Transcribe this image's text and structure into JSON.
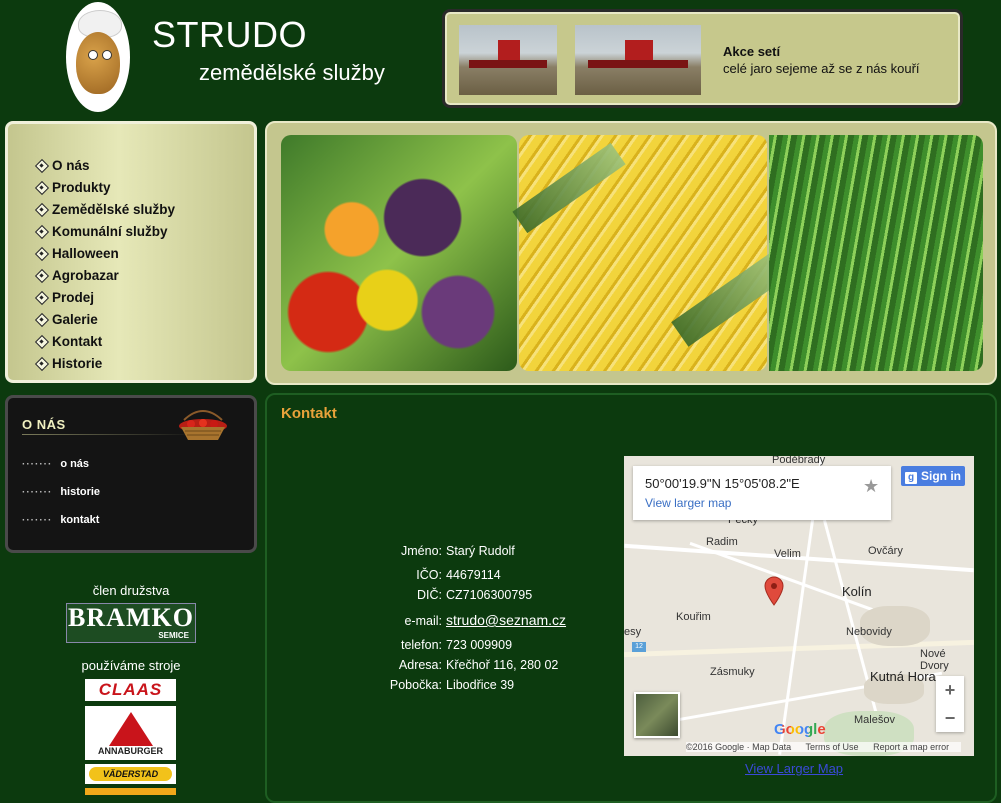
{
  "header": {
    "title": "STRUDO",
    "subtitle": "zemědělské služby"
  },
  "promo": {
    "title": "Akce setí",
    "text": "celé jaro sejeme až se z nás kouří"
  },
  "nav": {
    "items": [
      {
        "label": "O nás"
      },
      {
        "label": "Produkty"
      },
      {
        "label": "Zemědělské služby"
      },
      {
        "label": "Komunální služby"
      },
      {
        "label": "Halloween"
      },
      {
        "label": "Agrobazar"
      },
      {
        "label": "Prodej"
      },
      {
        "label": "Galerie"
      },
      {
        "label": "Kontakt"
      },
      {
        "label": "Historie"
      }
    ]
  },
  "section_box": {
    "title": "O NÁS",
    "dots": "·······",
    "links": [
      {
        "label": "o nás"
      },
      {
        "label": "historie"
      },
      {
        "label": "kontakt"
      }
    ]
  },
  "sidebar": {
    "member_text": "člen družstva",
    "bramko_logo": "BRAMKO",
    "bramko_sub": "SEMICE",
    "machines_text": "používáme stroje",
    "claas": "CLAAS",
    "annaburger": "ANNABURGER",
    "vaderstad": "VÄDERSTAD"
  },
  "content": {
    "title": "Kontakt",
    "fields": [
      {
        "label": "Jméno:",
        "value": "Starý Rudolf"
      },
      {
        "label": "IČO:",
        "value": "44679114"
      },
      {
        "label": "DIČ:",
        "value": "CZ7106300795"
      },
      {
        "label": "e-mail:",
        "value": "strudo@seznam.cz"
      },
      {
        "label": "telefon:",
        "value": "723 009909"
      },
      {
        "label": "Adresa:",
        "value": "Křečhoř 116, 280 02"
      },
      {
        "label": "Pobočka:",
        "value": "Libodřice 39"
      }
    ]
  },
  "map": {
    "coords": "50°00'19.9\"N 15°05'08.2\"E",
    "view_larger": "View larger map",
    "sign_in": "Sign in",
    "towns": [
      "Poděbrady",
      "Pecky",
      "Radim",
      "Velim",
      "Ovčáry",
      "Kolín",
      "Kouřim",
      "Nebovidy",
      "Zásmuky",
      "Kutná Hora",
      "Nové Dvory",
      "Malešov",
      "esy"
    ],
    "road_badge": "12",
    "attribution": "©2016 Google · Map Data",
    "terms": "Terms of Use",
    "report": "Report a map error",
    "google": "Google",
    "zoom_in": "+",
    "zoom_out": "−",
    "star": "★",
    "accent": "#e04a3c"
  },
  "view_larger_link": "View Larger Map"
}
